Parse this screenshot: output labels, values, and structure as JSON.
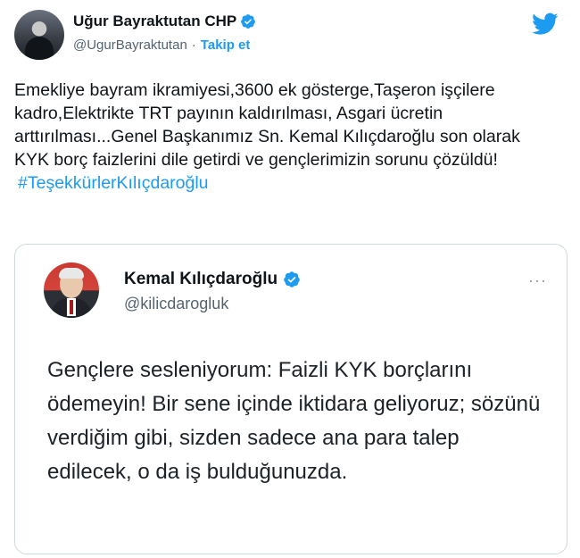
{
  "author": {
    "display_name": "Uğur Bayraktutan CHP",
    "handle": "@UgurBayraktutan",
    "separator": "·",
    "follow_label": "Takip et"
  },
  "tweet": {
    "text": "Emekliye bayram ikramiyesi,3600 ek gösterge,Taşeron işçilere kadro,Elektrikte TRT payının kaldırılması, Asgari ücretin arttırılması...Genel Başkanımız Sn. Kemal Kılıçdaroğlu son olarak KYK borç faizlerini dile getirdi ve gençlerimizin sorunu çözüldü!",
    "hashtag": "#TeşekkürlerKılıçdaroğlu"
  },
  "quoted": {
    "display_name": "Kemal Kılıçdaroğlu",
    "handle": "@kilicdarogluk",
    "more_label": "···",
    "text": "Gençlere sesleniyorum: Faizli KYK borçlarını ödemeyin! Bir sene içinde iktidara geliyoruz; sözünü verdiğim gibi, sizden sadece ana para talep edilecek, o da iş bulduğunuzda."
  },
  "icons": {
    "verified": "verified-badge-icon",
    "brand": "twitter-bird-icon"
  },
  "colors": {
    "accent": "#1d9bf0",
    "text": "#0f1419",
    "muted": "#536471",
    "border": "#cfd9de"
  }
}
